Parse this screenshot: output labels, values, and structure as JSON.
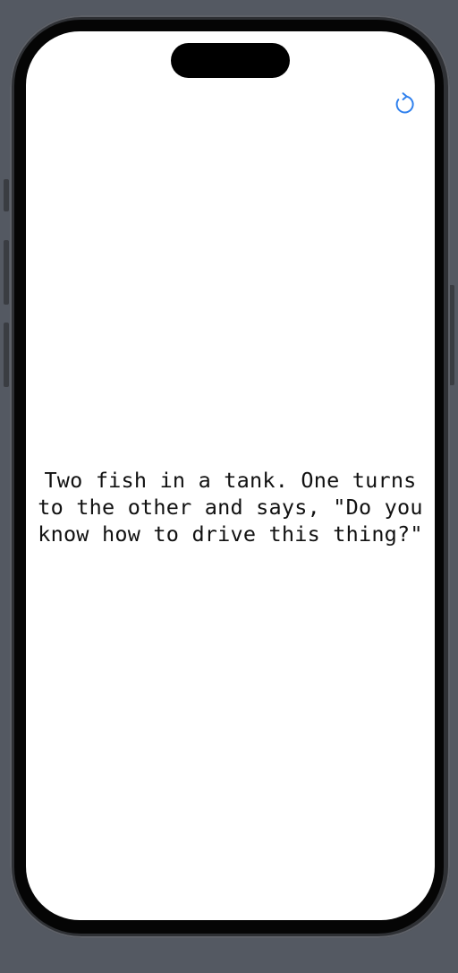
{
  "toolbar": {
    "refresh_icon": "arrow-clockwise-icon",
    "accent_color": "#2f80ed"
  },
  "joke": {
    "text": "Two fish in a tank. One turns\nto the other and says, \"Do you\nknow how to drive this thing?\""
  },
  "colors": {
    "background": "#545962",
    "screen": "#ffffff",
    "text": "#111111"
  }
}
